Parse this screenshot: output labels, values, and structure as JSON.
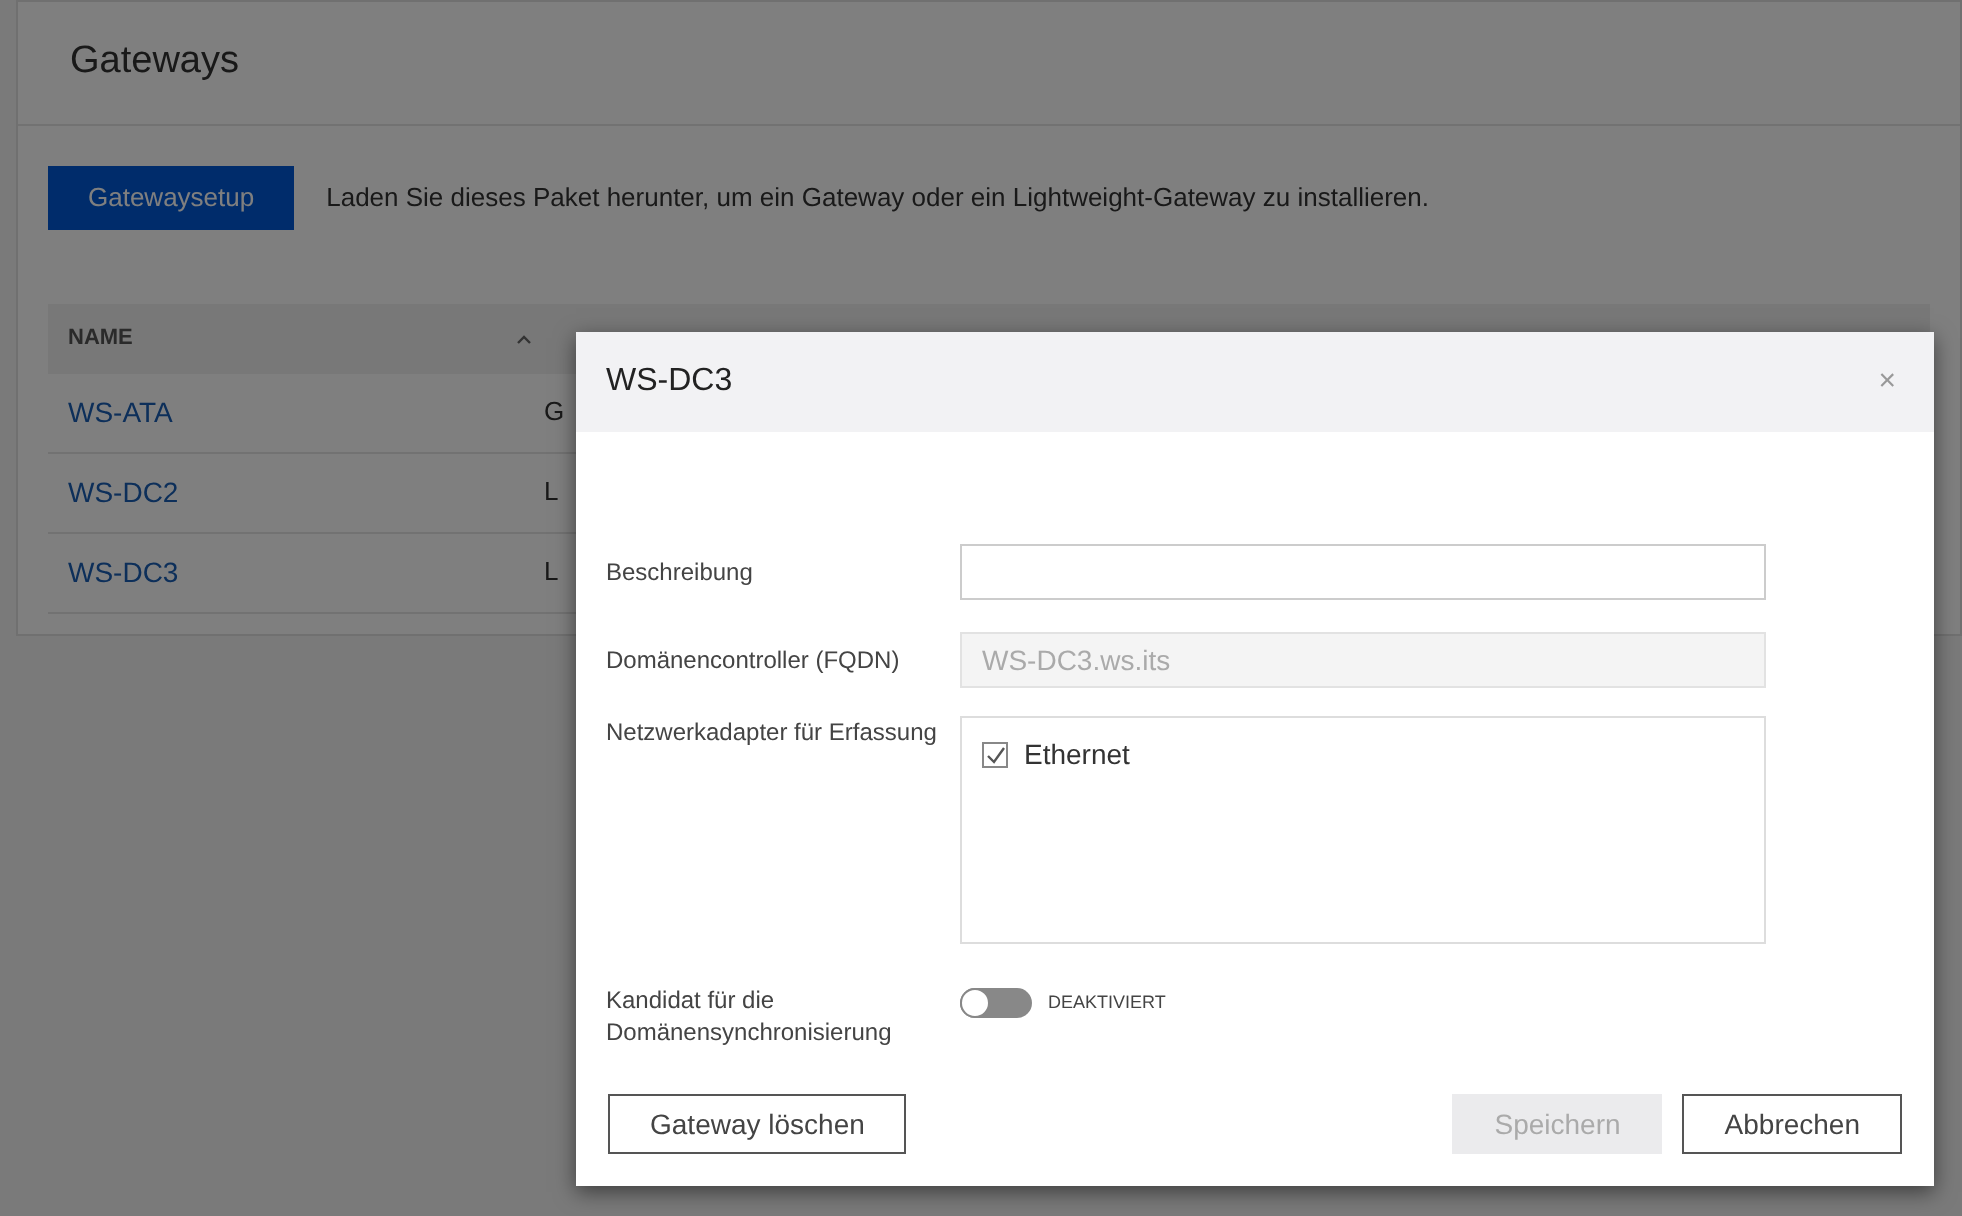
{
  "page": {
    "title": "Gateways"
  },
  "setup": {
    "button": "Gatewaysetup",
    "text": "Laden Sie dieses Paket herunter, um ein Gateway oder ein Lightweight-Gateway zu installieren."
  },
  "table": {
    "columns": [
      {
        "label": "NAME",
        "sorted": true
      }
    ],
    "rows": [
      {
        "name": "WS-ATA",
        "type": "G"
      },
      {
        "name": "WS-DC2",
        "type": "L"
      },
      {
        "name": "WS-DC3",
        "type": "L"
      }
    ]
  },
  "dialog": {
    "title": "WS-DC3",
    "close": "×",
    "fields": [
      {
        "kind": "text",
        "label": "Beschreibung",
        "disabled": false
      },
      {
        "kind": "text",
        "label": "Domänencontroller (FQDN)",
        "value": "WS-DC3.ws.its",
        "disabled": true
      },
      {
        "kind": "checklist",
        "label": "Netzwerkadapter für Erfassung",
        "items": [
          {
            "label": "Ethernet",
            "checked": true
          }
        ]
      },
      {
        "kind": "switch",
        "label": "Kandidat für die Domänensynchronisierung",
        "on": false,
        "state_text": "DEAKTIVIERT"
      }
    ],
    "buttons": [
      {
        "label": "Gateway löschen",
        "disabled": false
      },
      {
        "label": "Speichern",
        "disabled": true
      },
      {
        "label": "Abbrechen",
        "disabled": false
      }
    ]
  }
}
